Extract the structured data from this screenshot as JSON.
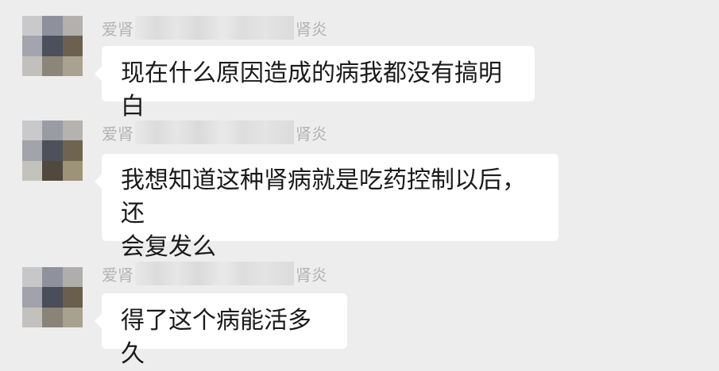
{
  "colors": {
    "background": "#ededed",
    "bubble": "#ffffff",
    "sender_text": "#b2b2b2",
    "message_text": "#1a1a1a"
  },
  "messages": [
    {
      "sender_prefix": "爱肾",
      "sender_suffix": "肾炎",
      "text": "现在什么原因造成的病我都没有搞明白",
      "avatar_colors": [
        "#c9c9cc",
        "#8e909b",
        "#b3b0ad",
        "#a4a4ae",
        "#4c4f5c",
        "#6c604f",
        "#c2c0bc",
        "#8c8679",
        "#a9a290"
      ]
    },
    {
      "sender_prefix": "爱肾",
      "sender_suffix": "肾炎",
      "text_line1": "我想知道这种肾病就是吃药控制以后，还",
      "text_line2": "会复发么",
      "avatar_colors": [
        "#c9c9cc",
        "#9a9ca5",
        "#b6b3ae",
        "#a3a3ac",
        "#4e505c",
        "#6f644f",
        "#c4c2bd",
        "#51493e",
        "#9d9378"
      ]
    },
    {
      "sender_prefix": "爱肾",
      "sender_suffix": "肾炎",
      "text": "得了这个病能活多久",
      "avatar_colors": [
        "#c7c7ca",
        "#8f919c",
        "#b0aeaa",
        "#a2a2ac",
        "#4a4d5a",
        "#6a5e4d",
        "#c3c1bd",
        "#8a8477",
        "#a8a18f"
      ]
    }
  ]
}
